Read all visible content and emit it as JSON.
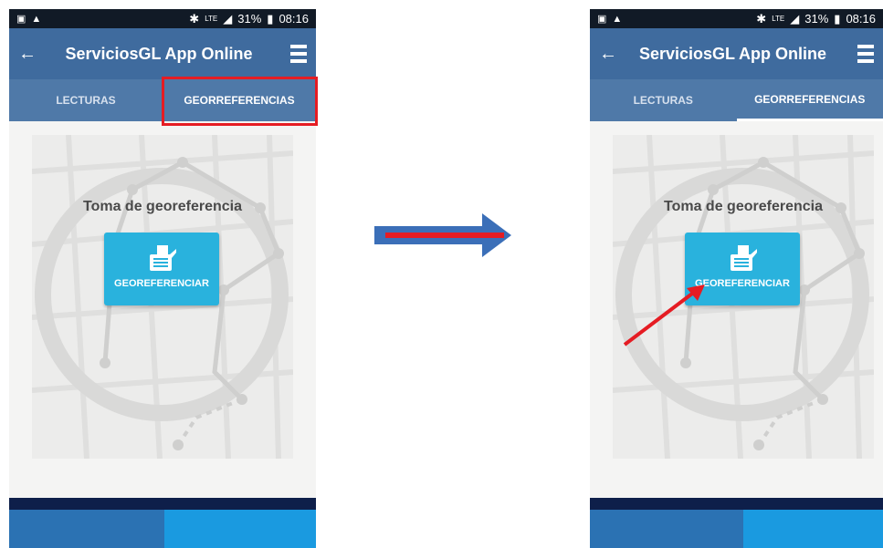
{
  "status_bar": {
    "signal": "LTE",
    "battery": "31%",
    "time": "08:16"
  },
  "app_title": "ServiciosGL App Online",
  "tabs": [
    {
      "label": "LECTURAS"
    },
    {
      "label": "GEORREFERENCIAS"
    }
  ],
  "main": {
    "title": "Toma de georeferencia",
    "button_label": "GEOREFERENCIAR"
  },
  "colors": {
    "appbar": "#3f6b9e",
    "tabbar": "#4f79a8",
    "button": "#29b2dd",
    "highlight": "#e51c23",
    "arrow": "#3b6fb8"
  },
  "icons": {
    "back": "arrow-left-icon",
    "menu": "hamburger-menu-icon",
    "button": "printer-list-icon"
  }
}
